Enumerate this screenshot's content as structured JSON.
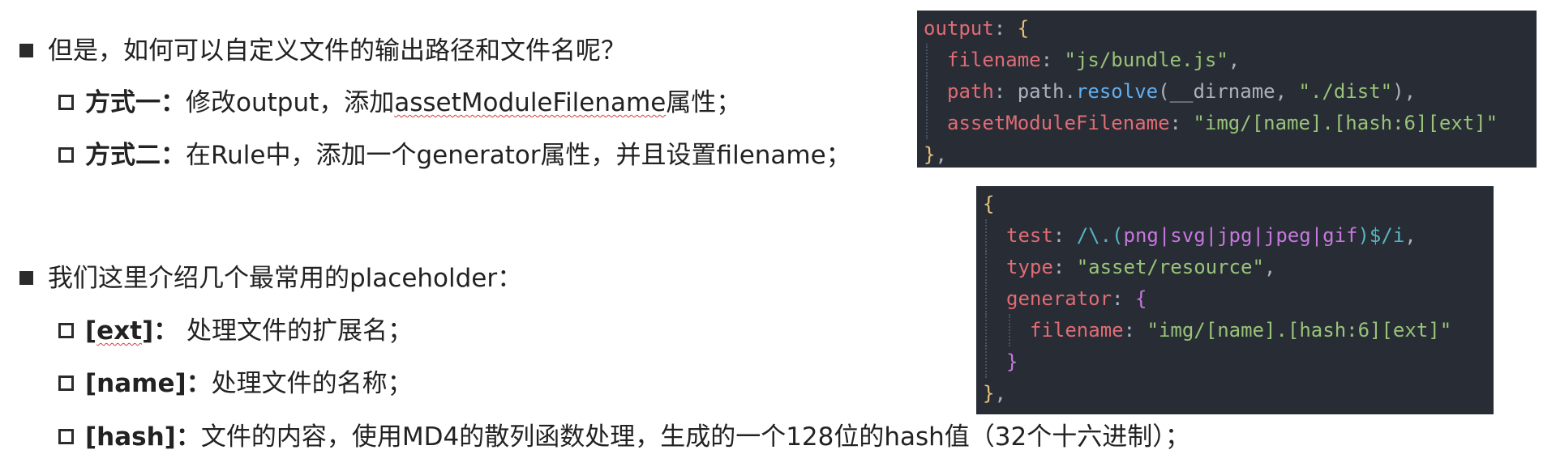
{
  "bullets": {
    "b1": "但是，如何可以自定义文件的输出路径和文件名呢？",
    "b1_1_label": "方式一：",
    "b1_1_pre": "修改output，添加",
    "b1_1_word": "assetModuleFilename",
    "b1_1_post": "属性；",
    "b1_2_label": "方式二：",
    "b1_2_text": "在Rule中，添加一个generator属性，并且设置filename；",
    "b2": "我们这里介绍几个最常用的placeholder：",
    "ext_bracket1": "[",
    "ext_word": "ext",
    "ext_bracket2": "]：",
    "ext_text": " 处理文件的扩展名；",
    "name_label": "[name]：",
    "name_text": "处理文件的名称；",
    "hash_label": "[hash]：",
    "hash_text": "文件的内容，使用MD4的散列函数处理，生成的一个128位的hash值（32个十六进制）；"
  },
  "code1": {
    "t_output": "output",
    "t_colon": ": ",
    "t_brace": "{",
    "t_filename": "filename",
    "t_colon2": ": ",
    "v_filename": "\"js/bundle.js\"",
    "t_comma": ",",
    "t_path": "path",
    "t_colon3": ": ",
    "t_pathobj": "path",
    "t_dot": ".",
    "t_resolve": "resolve",
    "t_paren": "(",
    "t_dirname": "__dirname",
    "t_sep": ", ",
    "v_dist": "\"./dist\"",
    "t_paren2": ")",
    "t_comma2": ",",
    "t_amf": "assetModuleFilename",
    "t_colon4": ": ",
    "v_amf": "\"img/[name].[hash:6][ext]\"",
    "t_close": "}",
    "t_close_comma": ","
  },
  "code2": {
    "t_open": "{",
    "t_test": "test",
    "t_colon": ": ",
    "v_regex_a": "/\\.(",
    "v_regex_b": "png|svg|jpg|jpeg|gif",
    "v_regex_c": ")$/i",
    "t_comma": ",",
    "t_type": "type",
    "t_colon2": ": ",
    "v_type": "\"asset/resource\"",
    "t_comma2": ",",
    "t_generator": "generator",
    "t_colon3": ": ",
    "t_gen_open": "{",
    "t_filename": "filename",
    "t_colon4": ": ",
    "v_filename": "\"img/[name].[hash:6][ext]\"",
    "t_gen_close": "}",
    "t_close": "}",
    "t_close_comma": ","
  }
}
